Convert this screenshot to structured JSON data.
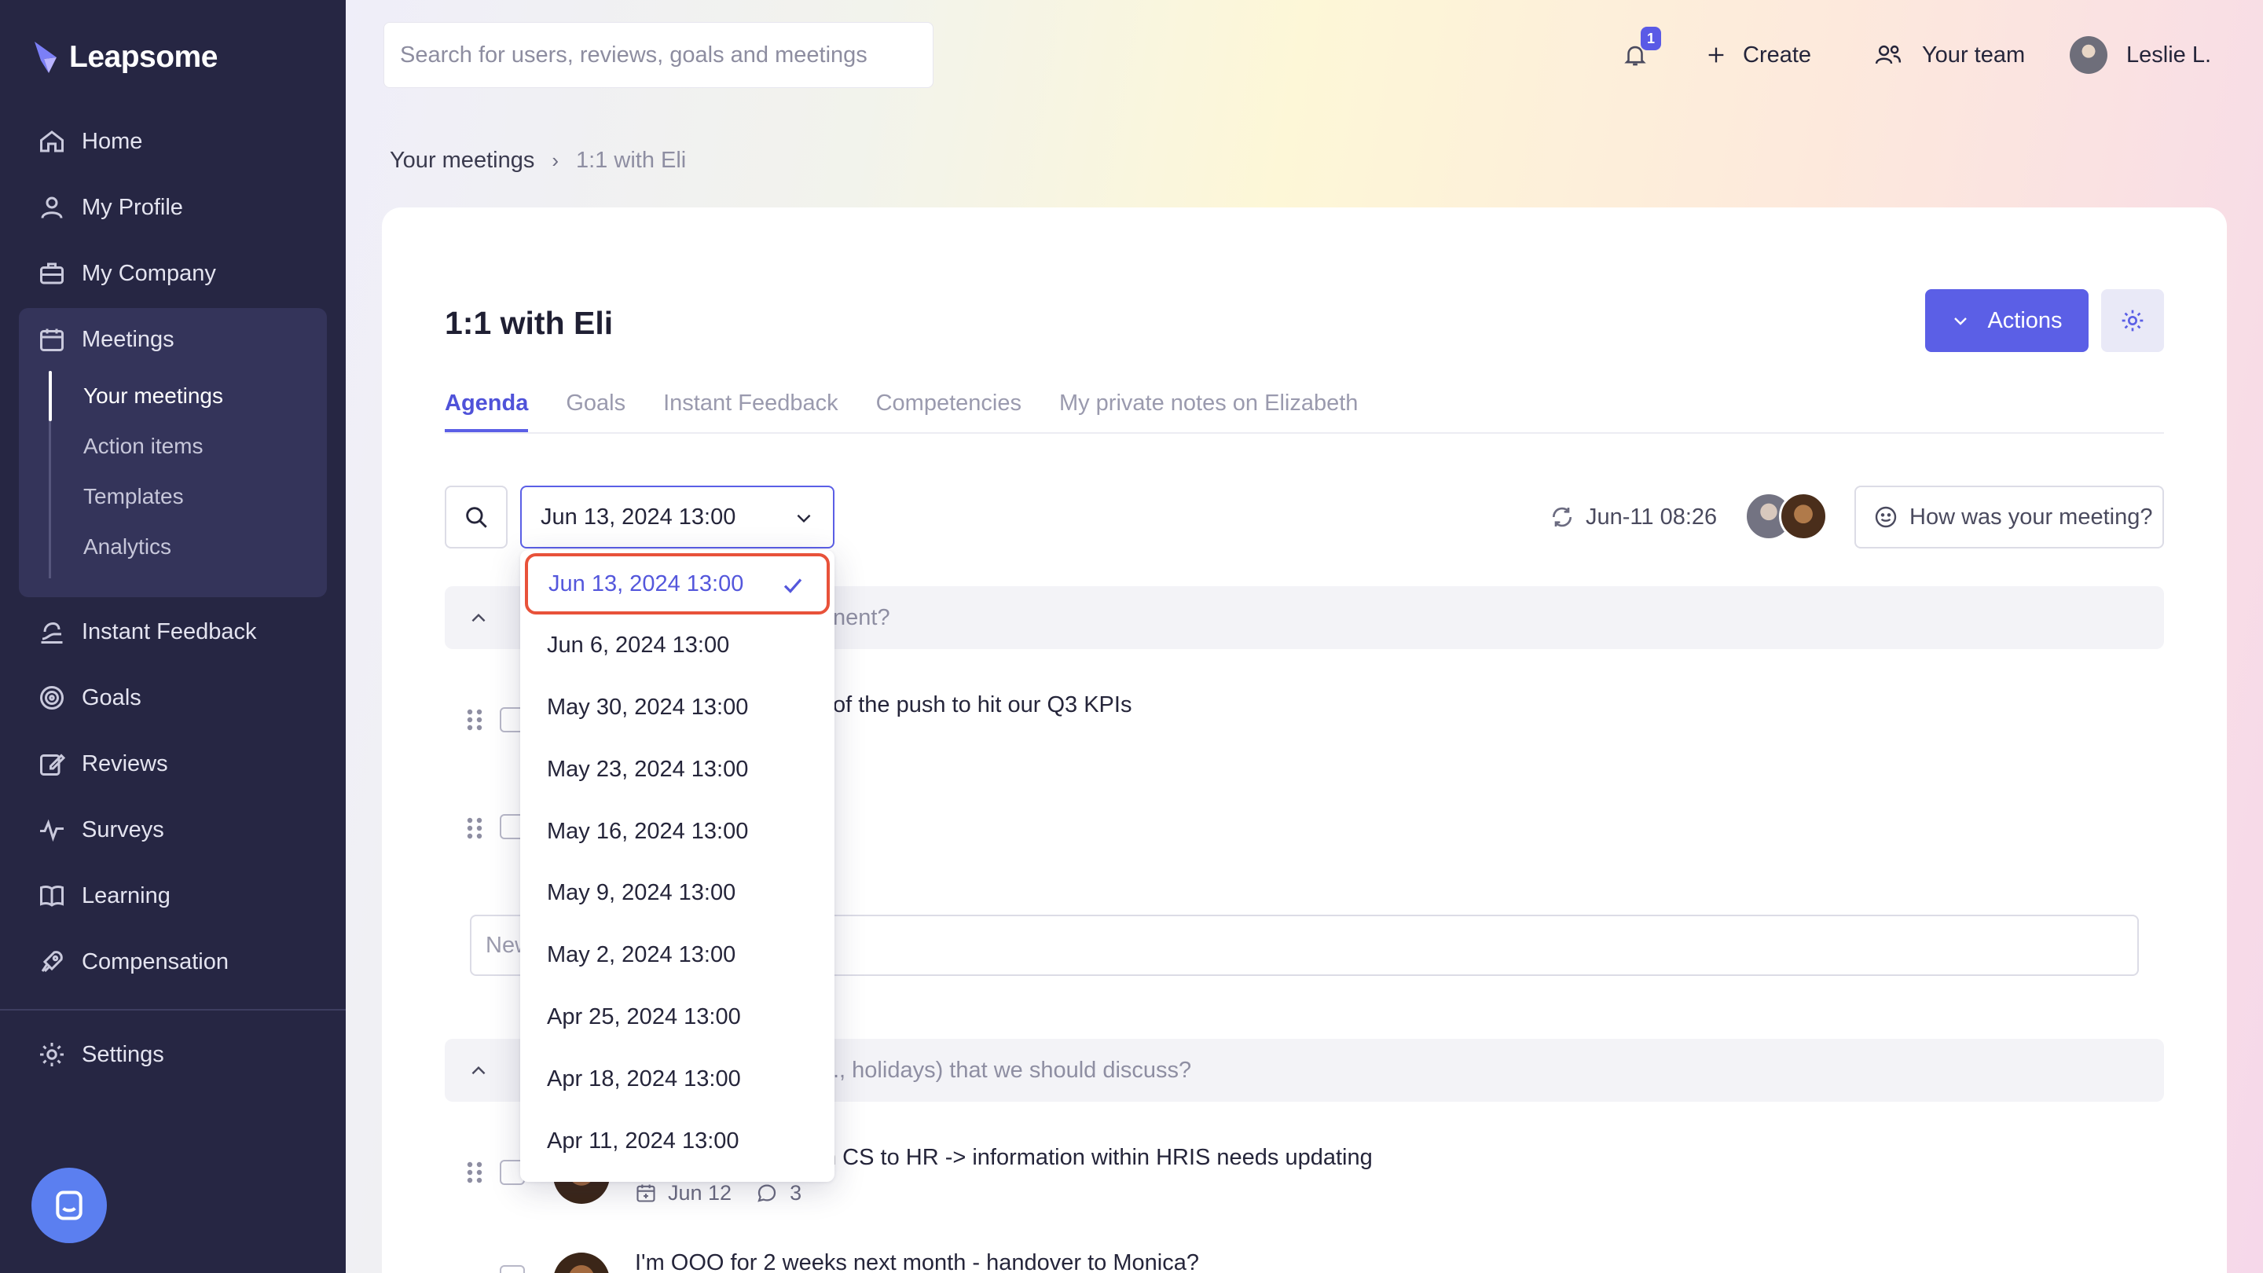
{
  "app": {
    "name": "Leapsome"
  },
  "sidebar": {
    "items": [
      {
        "label": "Home",
        "icon": "home-icon"
      },
      {
        "label": "My Profile",
        "icon": "user-icon"
      },
      {
        "label": "My Company",
        "icon": "briefcase-icon"
      },
      {
        "label": "Meetings",
        "icon": "calendar-icon"
      },
      {
        "label": "Instant Feedback",
        "icon": "feedback-icon"
      },
      {
        "label": "Goals",
        "icon": "target-icon"
      },
      {
        "label": "Reviews",
        "icon": "edit-icon"
      },
      {
        "label": "Surveys",
        "icon": "pulse-icon"
      },
      {
        "label": "Learning",
        "icon": "book-icon"
      },
      {
        "label": "Compensation",
        "icon": "rocket-icon"
      },
      {
        "label": "Settings",
        "icon": "gear-icon"
      }
    ],
    "meetings_sub": [
      {
        "label": "Your meetings",
        "active": true
      },
      {
        "label": "Action items"
      },
      {
        "label": "Templates"
      },
      {
        "label": "Analytics"
      }
    ]
  },
  "topbar": {
    "search_placeholder": "Search for users, reviews, goals and meetings",
    "notification_count": "1",
    "create_label": "Create",
    "team_label": "Your team",
    "user_label": "Leslie L."
  },
  "breadcrumb": {
    "parent": "Your meetings",
    "current": "1:1 with Eli"
  },
  "page": {
    "title": "1:1 with Eli",
    "actions_label": "Actions",
    "tabs": [
      {
        "label": "Agenda",
        "active": true
      },
      {
        "label": "Goals"
      },
      {
        "label": "Instant Feedback"
      },
      {
        "label": "Competencies"
      },
      {
        "label": "My private notes on Elizabeth"
      }
    ],
    "selected_date": "Jun 13, 2024 13:00",
    "sync_time": "Jun-11 08:26",
    "feedback_button": "How was your meeting?",
    "new_input_placeholder": "New",
    "section1_text": "nent?",
    "section2_text": "., holidays) that we should discuss?",
    "row1_text": "of the push to hit our Q3 KPIs",
    "row3_text": "n CS to HR -> information within HRIS needs updating",
    "row3_date": "Jun 12",
    "row3_comments": "3",
    "row4_text": "I'm OOO for 2 weeks next month - handover to Monica?"
  },
  "dropdown": {
    "options": [
      "Jun 13, 2024 13:00",
      "Jun 6, 2024 13:00",
      "May 30, 2024 13:00",
      "May 23, 2024 13:00",
      "May 16, 2024 13:00",
      "May 9, 2024 13:00",
      "May 2, 2024 13:00",
      "Apr 25, 2024 13:00",
      "Apr 18, 2024 13:00",
      "Apr 11, 2024 13:00"
    ],
    "selected_index": 0
  },
  "colors": {
    "sidebar_bg": "#262643",
    "accent": "#5b5fe6",
    "highlight_border": "#e8523a"
  }
}
